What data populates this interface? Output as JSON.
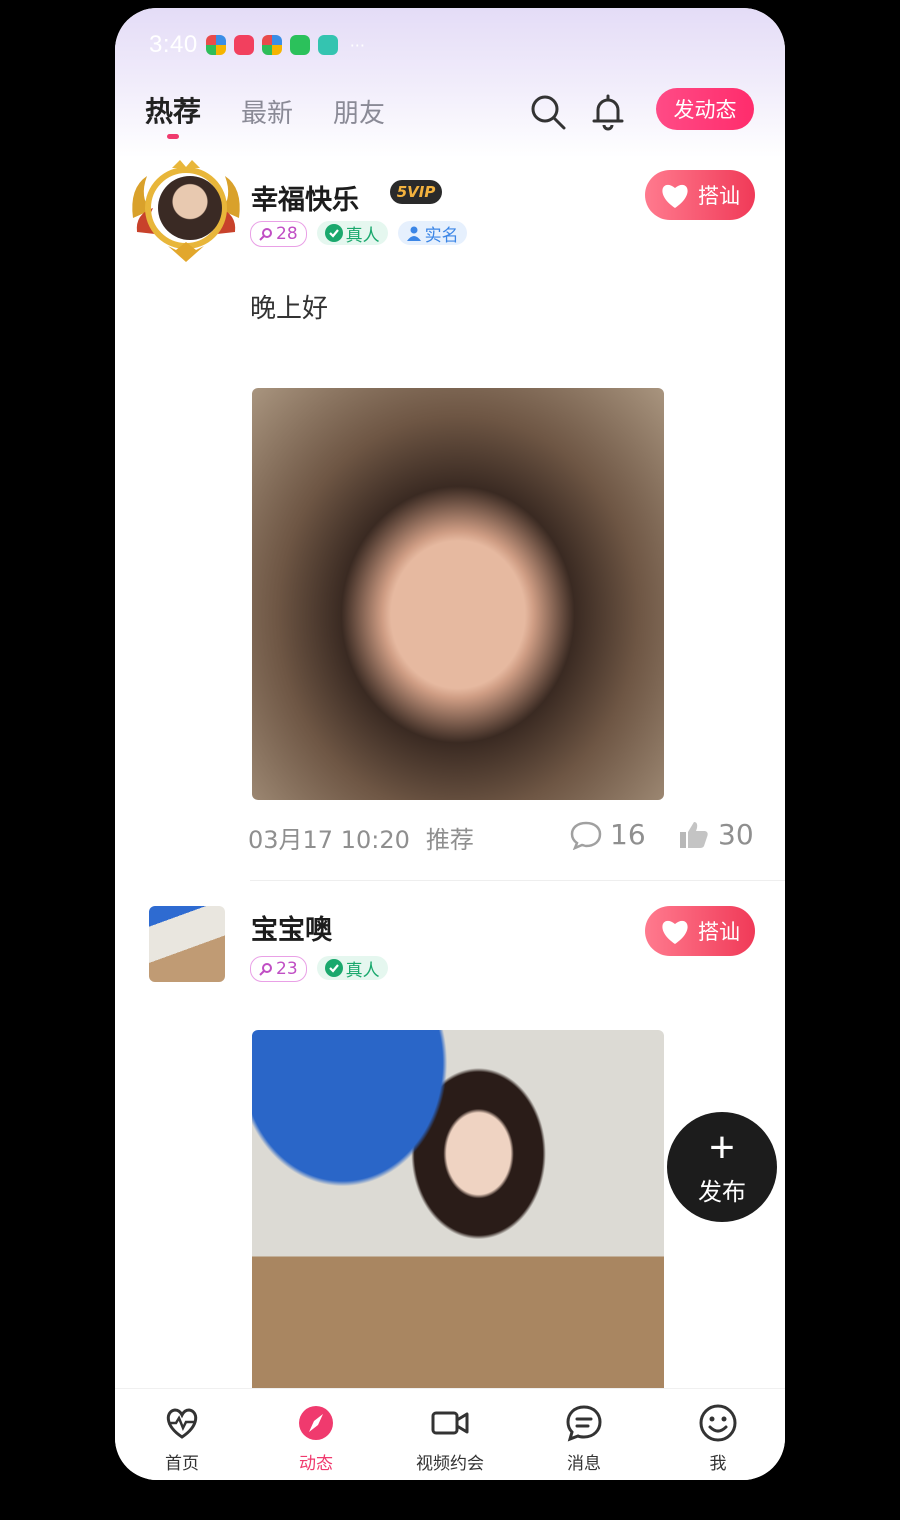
{
  "status": {
    "time": "3:40"
  },
  "header": {
    "tabs": [
      {
        "label": "热荐",
        "active": true
      },
      {
        "label": "最新",
        "active": false
      },
      {
        "label": "朋友",
        "active": false
      }
    ],
    "post_button": "发动态"
  },
  "posts": [
    {
      "username": "幸福快乐",
      "vip": "5",
      "badges": {
        "age": "28",
        "real": "真人",
        "realname": "实名"
      },
      "action": "搭讪",
      "text": "晚上好",
      "time": "03月17 10:20",
      "tag": "推荐",
      "comments": "16",
      "likes": "30"
    },
    {
      "username": "宝宝噢",
      "badges": {
        "age": "23",
        "real": "真人"
      },
      "action": "搭讪"
    }
  ],
  "fab": {
    "label": "发布"
  },
  "nav": [
    {
      "label": "首页",
      "icon": "heartbeat-icon"
    },
    {
      "label": "动态",
      "icon": "compass-icon",
      "active": true
    },
    {
      "label": "视频约会",
      "icon": "video-camera-icon"
    },
    {
      "label": "消息",
      "icon": "chat-icon"
    },
    {
      "label": "我",
      "icon": "smile-icon"
    }
  ],
  "colors": {
    "accent": "#f03a6e",
    "verified": "#1aa86d",
    "fab": "#1c1c1c"
  }
}
